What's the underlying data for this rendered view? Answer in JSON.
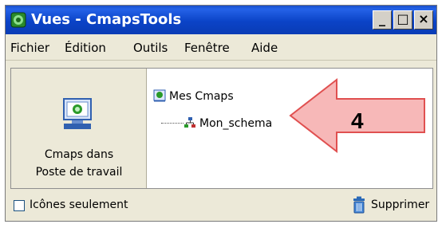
{
  "window": {
    "title": "Vues - CmapsTools"
  },
  "title_buttons": {
    "minimize": "_",
    "maximize": "□",
    "close": "×"
  },
  "menu": [
    "Fichier",
    "Édition",
    "Outils",
    "Fenêtre",
    "Aide"
  ],
  "left_pane": {
    "label_line1": "Cmaps dans",
    "label_line2": "Poste de travail",
    "icon": "computer-icon"
  },
  "tree": {
    "root": "Mes Cmaps",
    "child": "Mon_schema"
  },
  "bottom": {
    "checkbox_label": "Icônes seulement",
    "checkbox_checked": false,
    "delete_label": "Supprimer"
  },
  "annotation": {
    "number": "4",
    "color": "#f7b8b8"
  },
  "colors": {
    "titlebar": "#0b43c7",
    "window_bg": "#ece9d8",
    "panel_bg": "#ffffff"
  }
}
